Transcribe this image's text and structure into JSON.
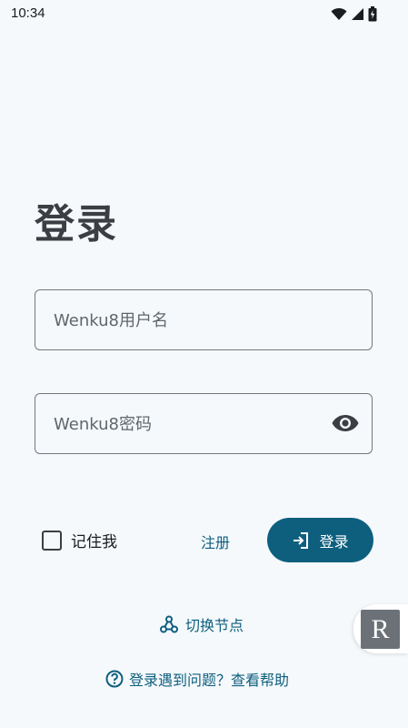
{
  "status_bar": {
    "time": "10:34"
  },
  "login": {
    "title": "登录",
    "username": {
      "placeholder": "Wenku8用户名",
      "value": ""
    },
    "password": {
      "placeholder": "Wenku8密码",
      "value": ""
    },
    "remember_me_label": "记住我",
    "remember_me_checked": false,
    "register_label": "注册",
    "login_button_label": "登录",
    "switch_node_label": "切换节点",
    "help_label": "登录遇到问题？查看帮助"
  },
  "floating_button": {
    "label": "R"
  },
  "colors": {
    "background": "#f5f9fc",
    "accent": "#0e5f7e",
    "title": "#3b3e42",
    "outline": "#72787e"
  },
  "icons": {
    "wifi": "wifi-icon",
    "signal": "signal-icon",
    "battery": "battery-icon",
    "eye": "eye-icon",
    "login": "login-arrow-icon",
    "switch_node": "network-node-icon",
    "help": "help-circle-icon"
  }
}
